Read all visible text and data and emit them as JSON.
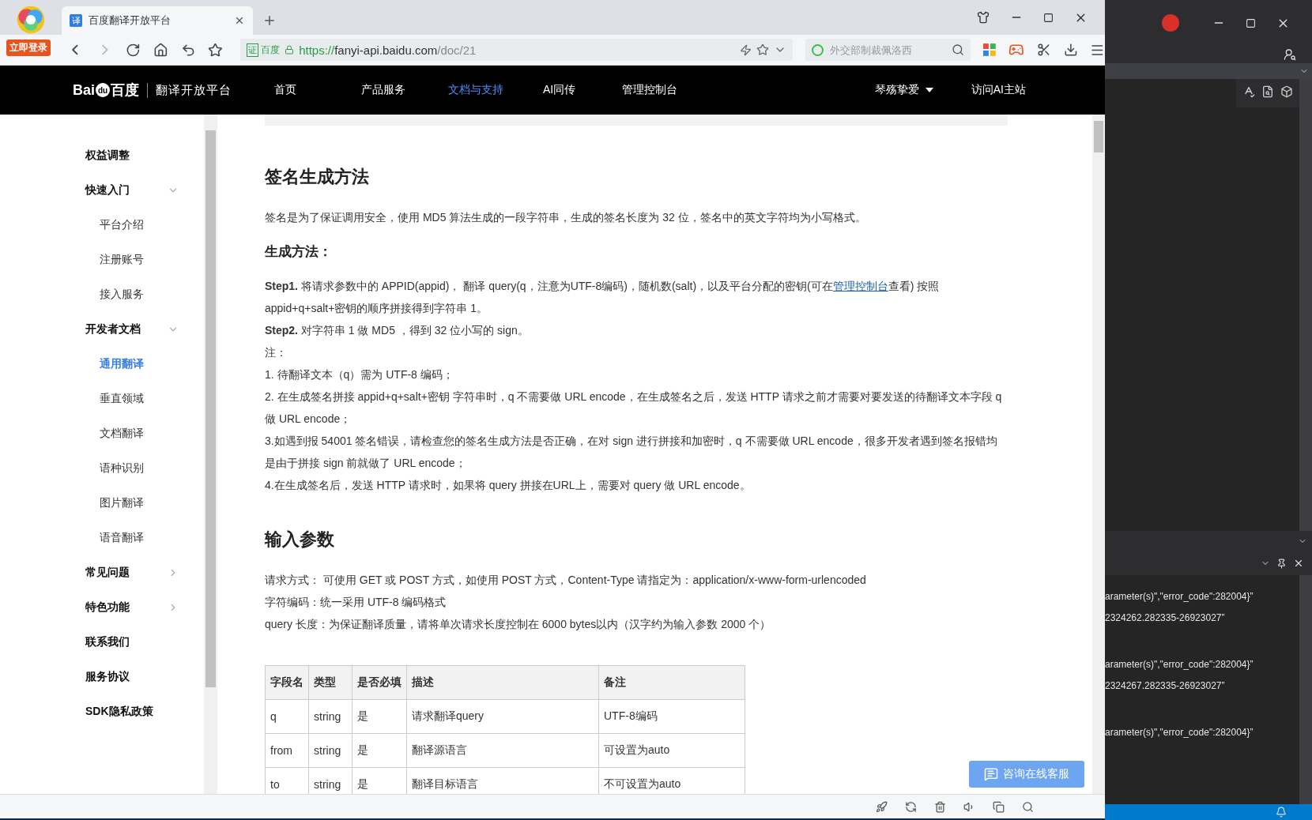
{
  "browser": {
    "login_badge": "立即登录",
    "tab": {
      "title": "百度翻译开放平台",
      "favicon": "译"
    },
    "cert_label": "百度",
    "cert_mark": "证",
    "url": {
      "scheme": "https://",
      "host": "fanyi-api.baidu.com",
      "path": "/doc/21"
    },
    "search": {
      "placeholder": "外交部制裁佩洛西"
    }
  },
  "site_nav": {
    "logo_left": "Bai",
    "logo_paw": "du",
    "logo_right": "百度",
    "platform": "翻译开放平台",
    "items": [
      {
        "label": "首页",
        "selected": false
      },
      {
        "label": "产品服务",
        "selected": false
      },
      {
        "label": "文档与支持",
        "selected": true
      },
      {
        "label": "AI同传",
        "selected": false
      },
      {
        "label": "管理控制台",
        "selected": false
      }
    ],
    "user": "琴殇挚爱",
    "site_link": "访问AI主站"
  },
  "sidebar": {
    "items": [
      {
        "label": "权益调整"
      },
      {
        "label": "快速入门",
        "expanded": true,
        "children": [
          {
            "label": "平台介绍",
            "selected": false
          },
          {
            "label": "注册账号",
            "selected": false
          },
          {
            "label": "接入服务",
            "selected": false
          }
        ]
      },
      {
        "label": "开发者文档",
        "expanded": true,
        "children": [
          {
            "label": "通用翻译",
            "selected": true
          },
          {
            "label": "垂直领域",
            "selected": false
          },
          {
            "label": "文档翻译",
            "selected": false
          },
          {
            "label": "语种识别",
            "selected": false
          },
          {
            "label": "图片翻译",
            "selected": false
          },
          {
            "label": "语音翻译",
            "selected": false
          }
        ]
      },
      {
        "label": "常见问题",
        "expanded": false
      },
      {
        "label": "特色功能",
        "expanded": false
      },
      {
        "label": "联系我们"
      },
      {
        "label": "服务协议"
      },
      {
        "label": "SDK隐私政策"
      }
    ]
  },
  "content": {
    "blocks": [
      {
        "kind": "heading",
        "text": "签名生成方法"
      },
      {
        "kind": "para",
        "text": "签名是为了保证调用安全，使用 MD5 算法生成的一段字符串，生成的签名长度为 32 位，签名中的英文字符均为小写格式。"
      },
      {
        "kind": "subheading",
        "text": "生成方法："
      },
      {
        "kind": "linkpara",
        "before": "**Step1.** 将请求参数中的 APPID(appid)， 翻译 query(q，注意为UTF-8编码)，随机数(salt)，以及平台分配的密钥(可在",
        "link": "管理控制台",
        "after": "查看) 按照 appid+q+salt+密钥的顺序拼接得到字符串 1。"
      },
      {
        "kind": "line",
        "text": "**Step2.** 对字符串 1 做 MD5 ，得到 32 位小写的 sign。"
      },
      {
        "kind": "line",
        "text": "注："
      },
      {
        "kind": "line",
        "text": "1. 待翻译文本（q）需为 UTF-8 编码；"
      },
      {
        "kind": "line",
        "text": "2. 在生成签名拼接 appid+q+salt+密钥 字符串时，q 不需要做 URL encode，在生成签名之后，发送 HTTP 请求之前才需要对要发送的待翻译文本字段 q 做 URL encode；"
      },
      {
        "kind": "line",
        "text": "3.如遇到报 54001 签名错误，请检查您的签名生成方法是否正确，在对 sign 进行拼接和加密时，q 不需要做 URL encode，很多开发者遇到签名报错均是由于拼接 sign 前就做了 URL encode；"
      },
      {
        "kind": "line",
        "text": "4.在生成签名后，发送 HTTP 请求时，如果将 query 拼接在URL上，需要对 query 做 URL encode。"
      },
      {
        "kind": "heading",
        "text": "输入参数"
      },
      {
        "kind": "line",
        "text": "请求方式： 可使用 GET 或 POST 方式，如使用 POST 方式，Content-Type 请指定为：application/x-www-form-urlencoded"
      },
      {
        "kind": "line",
        "text": "字符编码：统一采用 UTF-8 编码格式"
      },
      {
        "kind": "line",
        "text": "query 长度：为保证翻译质量，请将单次请求长度控制在 6000 bytes以内（汉字约为输入参数 2000 个）"
      }
    ],
    "table": {
      "columns": [
        "字段名",
        "类型",
        "是否必填",
        "描述",
        "备注"
      ],
      "rows": [
        [
          "q",
          "string",
          "是",
          "请求翻译query",
          "UTF-8编码"
        ],
        [
          "from",
          "string",
          "是",
          "翻译源语言",
          "可设置为auto"
        ],
        [
          "to",
          "string",
          "是",
          "翻译目标语言",
          "不可设置为auto"
        ]
      ]
    },
    "chat_button": "咨询在线客服"
  },
  "ide": {
    "output_blocks": [
      [
        "arameter(s)\",\"error_code\":282004}”",
        "2324262.282335-26923027”"
      ],
      [
        "arameter(s)\",\"error_code\":282004}”",
        "2324267.282335-26923027”"
      ],
      [
        "arameter(s)\",\"error_code\":282004}”"
      ]
    ]
  }
}
